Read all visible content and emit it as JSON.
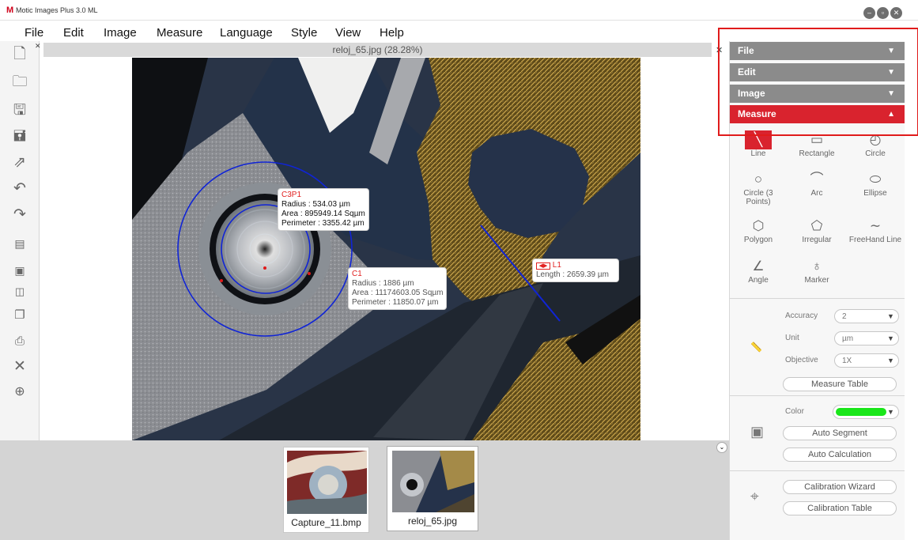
{
  "app": {
    "title": "Motic Images Plus 3.0 ML",
    "logo": "M"
  },
  "menu": [
    "File",
    "Edit",
    "Image",
    "Measure",
    "Language",
    "Style",
    "View",
    "Help"
  ],
  "document": {
    "title": "reloj_65.jpg (28.28%)"
  },
  "left_toolbar": [
    "new-icon",
    "open-icon",
    "save-icon",
    "save-as-icon",
    "export-icon",
    "undo-icon",
    "redo-icon",
    "video-icon",
    "capture-icon",
    "compare-icon",
    "gallery-icon",
    "print-icon",
    "tools-icon",
    "zoom-in-icon"
  ],
  "annotations": {
    "c3p1": {
      "name": "C3P1",
      "radius": "Radius : 534.03 µm",
      "area": "Area : 895949.14 Sqµm",
      "perimeter": "Perimeter : 3355.42 µm"
    },
    "c1": {
      "name": "C1",
      "radius": "Radius : 1886 µm",
      "area": "Area : 11174603.05 Sqµm",
      "perimeter": "Perimeter : 11850.07 µm"
    },
    "l1": {
      "name": "L1",
      "length": "Length : 2659.39 µm"
    }
  },
  "thumbnails": [
    {
      "caption": "Capture_11.bmp"
    },
    {
      "caption": "reloj_65.jpg"
    }
  ],
  "panel": {
    "sections": [
      "File",
      "Edit",
      "Image",
      "Measure"
    ],
    "tools": {
      "line": "Line",
      "rectangle": "Rectangle",
      "circle": "Circle",
      "circle3": "Circle (3 Points)",
      "arc": "Arc",
      "ellipse": "Ellipse",
      "polygon": "Polygon",
      "irregular": "Irregular",
      "freehand": "FreeHand Line",
      "angle": "Angle",
      "marker": "Marker"
    },
    "accuracy_label": "Accuracy",
    "accuracy_value": "2",
    "unit_label": "Unit",
    "unit_value": "µm",
    "objective_label": "Objective",
    "objective_value": "1X",
    "measure_table": "Measure Table",
    "color_label": "Color",
    "color_value": "#19e619",
    "auto_segment": "Auto Segment",
    "auto_calculation": "Auto Calculation",
    "calibration_wizard": "Calibration Wizard",
    "calibration_table": "Calibration Table"
  },
  "colors": {
    "accent_red": "#d9232e",
    "accordion_gray": "#858585",
    "measure_blue": "#1428d8"
  }
}
